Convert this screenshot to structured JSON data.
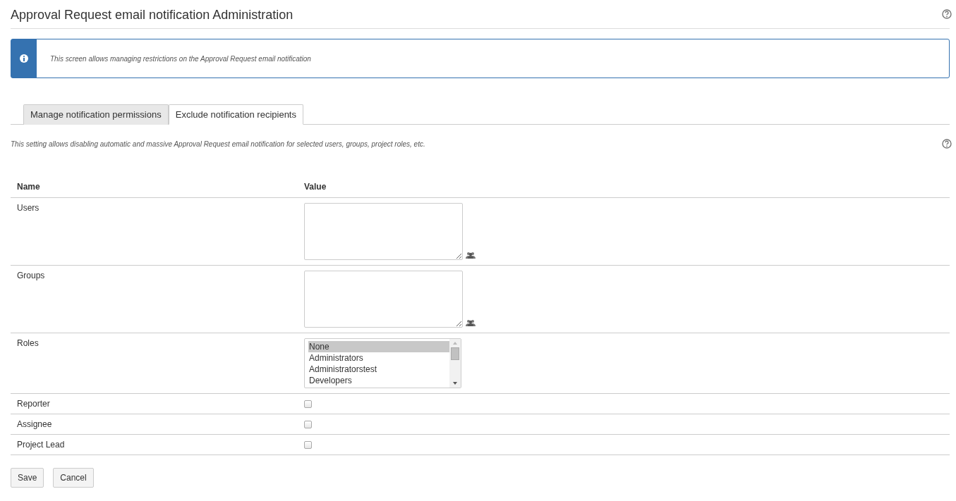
{
  "page": {
    "title": "Approval Request email notification Administration"
  },
  "info_banner": {
    "message": "This screen allows managing restrictions on the Approval Request email notification"
  },
  "tabs": [
    {
      "label": "Manage notification permissions",
      "selected": false
    },
    {
      "label": "Exclude notification recipients",
      "selected": true
    }
  ],
  "description": "This setting allows disabling automatic and massive Approval Request email notification for selected users, groups, project roles, etc.",
  "table": {
    "columns": [
      "Name",
      "Value"
    ],
    "rows": [
      {
        "name": "Users",
        "kind": "textarea"
      },
      {
        "name": "Groups",
        "kind": "textarea"
      },
      {
        "name": "Roles",
        "kind": "listbox",
        "options": [
          {
            "label": "None",
            "selected": true
          },
          {
            "label": "Administrators",
            "selected": false
          },
          {
            "label": "Administratorstest",
            "selected": false
          },
          {
            "label": "Developers",
            "selected": false
          }
        ]
      },
      {
        "name": "Reporter",
        "kind": "checkbox",
        "checked": false
      },
      {
        "name": "Assignee",
        "kind": "checkbox",
        "checked": false
      },
      {
        "name": "Project Lead",
        "kind": "checkbox",
        "checked": false
      }
    ]
  },
  "buttons": [
    "Save",
    "Cancel"
  ]
}
